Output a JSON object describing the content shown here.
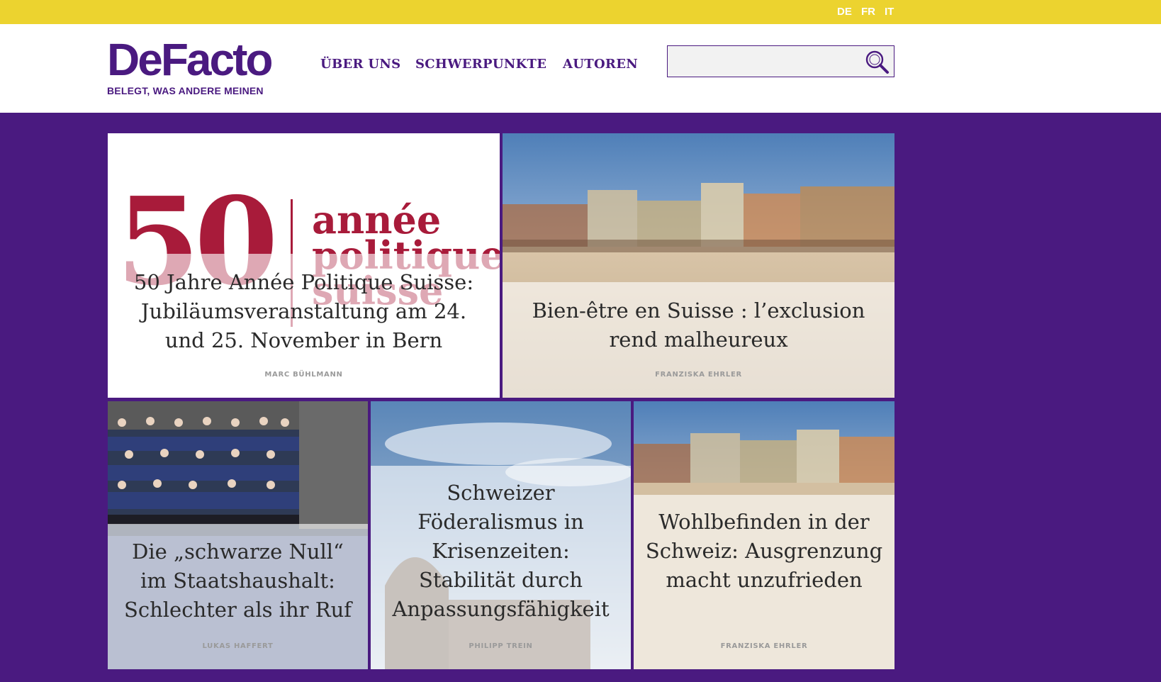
{
  "languages": [
    "DE",
    "FR",
    "IT"
  ],
  "logo": {
    "word": "DeFacto",
    "tagline": "BELEGT, WAS ANDERE MEINEN"
  },
  "nav": [
    "ÜBER UNS",
    "SCHWERPUNKTE",
    "AUTOREN"
  ],
  "search": {
    "value": "",
    "placeholder": ""
  },
  "colors": {
    "brand": "#4a1a80",
    "topbar": "#ecd32f",
    "accent_red": "#a81b3a"
  },
  "tiles": [
    {
      "title": "50 Jahre Année Politique Suisse: Jubiläumsveranstaltung am 24. und 25. November in Bern",
      "author": "MARC BÜHLMANN",
      "graphic": {
        "number": "50",
        "words": [
          "année",
          "politique",
          "suisse"
        ]
      }
    },
    {
      "title": "Bien-être en Suisse : l’exclusion rend malheureux",
      "author": "FRANZISKA EHRLER"
    },
    {
      "title": "Die „schwarze Null“ im Staatshaushalt: Schlechter als ihr Ruf",
      "author": "LUKAS HAFFERT"
    },
    {
      "title": "Schweizer Föderalismus in Krisenzeiten: Stabilität durch Anpassungsfähigkeit",
      "author": "PHILIPP TREIN"
    },
    {
      "title": "Wohlbefinden in der Schweiz: Ausgrenzung macht unzufrieden",
      "author": "FRANZISKA EHRLER"
    }
  ]
}
